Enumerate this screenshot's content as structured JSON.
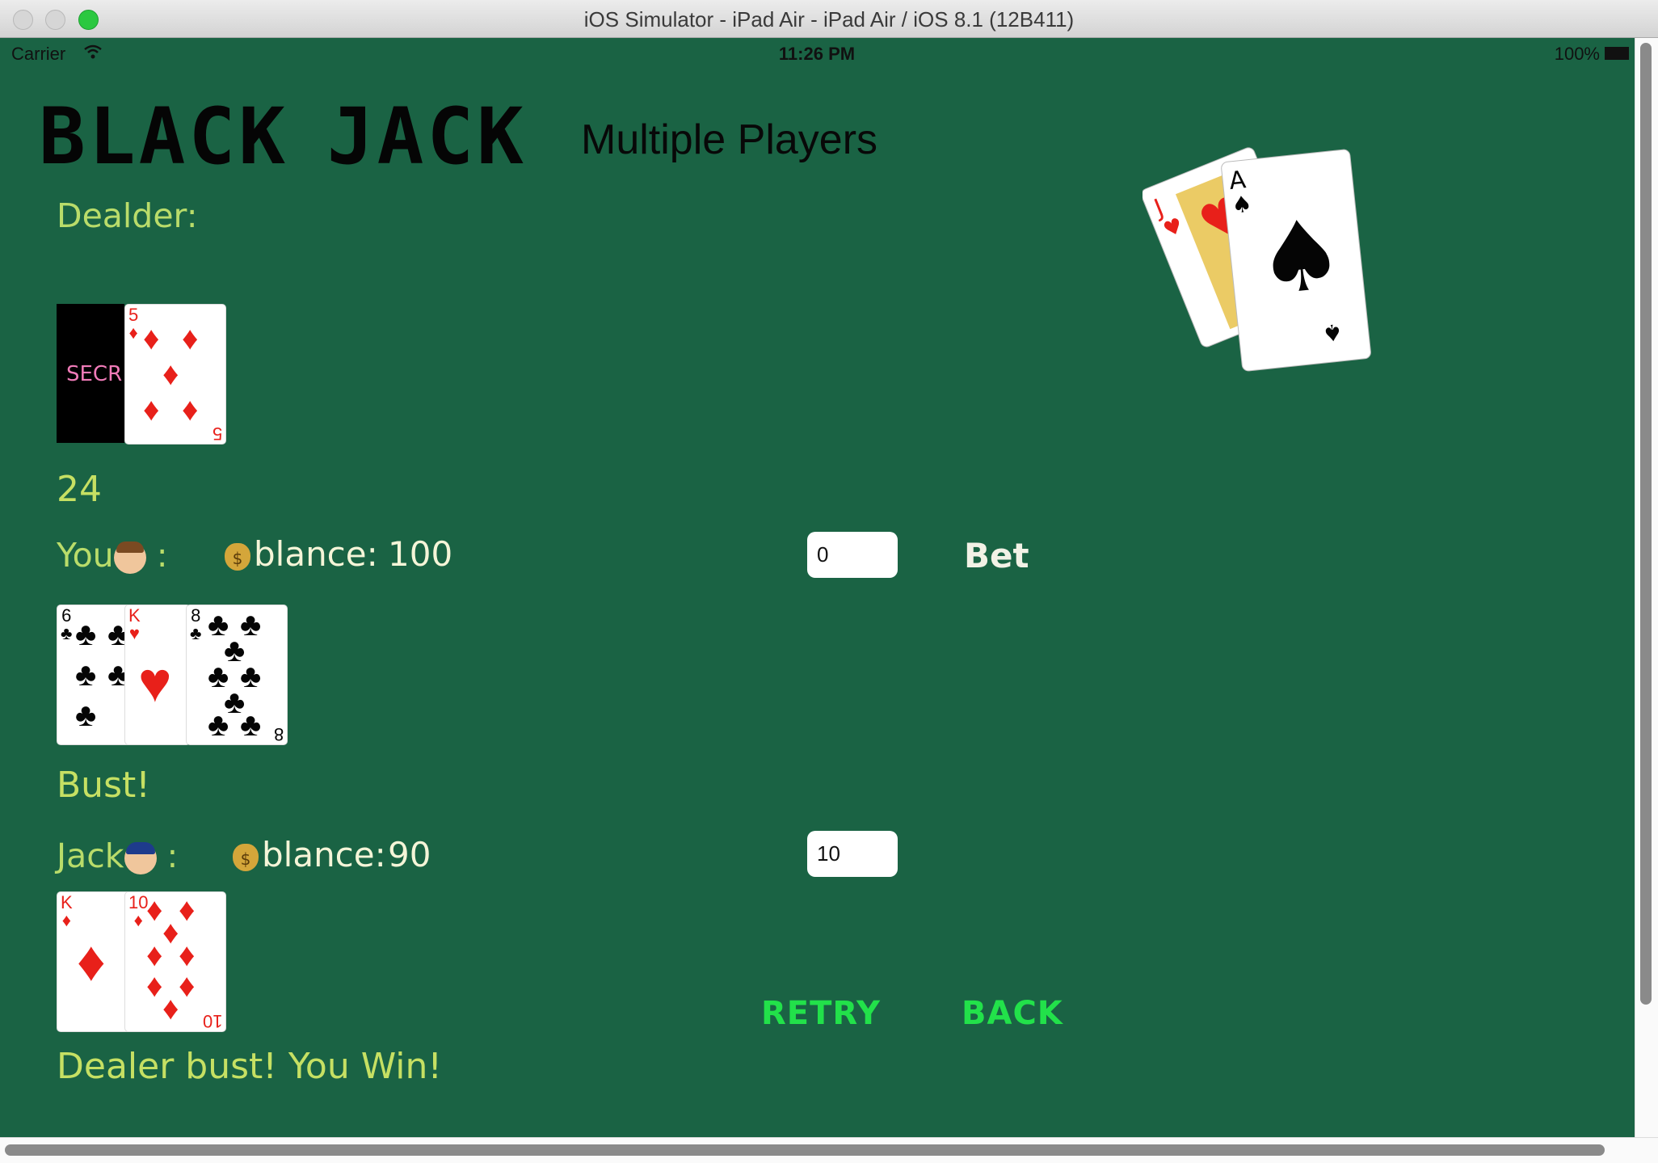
{
  "window": {
    "title": "iOS Simulator - iPad Air - iPad Air / iOS 8.1 (12B411)"
  },
  "status_bar": {
    "carrier": "Carrier",
    "time": "11:26 PM",
    "battery": "100%"
  },
  "header": {
    "title": "BLACK JACK",
    "subtitle": "Multiple Players"
  },
  "dealer": {
    "label": "Dealder:",
    "hidden_card_text": "SECR",
    "cards": [
      {
        "rank": "5",
        "suit": "♦",
        "color": "#e8201a"
      }
    ],
    "total": "24"
  },
  "players": [
    {
      "label": "You",
      "avatar": "boy-face-icon",
      "balance_label": "blance:",
      "balance": "100",
      "bet_value": "0",
      "cards": [
        {
          "rank": "6",
          "suit": "♣"
        },
        {
          "rank": "K",
          "suit": "♥"
        },
        {
          "rank": "8",
          "suit": "♣"
        }
      ],
      "result": "Bust!"
    },
    {
      "label": "Jack",
      "avatar": "police-face-icon",
      "balance_label": "blance:",
      "balance": "90",
      "bet_value": "10",
      "cards": [
        {
          "rank": "K",
          "suit": "♦"
        },
        {
          "rank": "10",
          "suit": "♦"
        }
      ],
      "result": "Dealer bust! You Win!"
    }
  ],
  "bet_button": "Bet",
  "actions": {
    "retry": "RETRY",
    "back": "BACK"
  },
  "colors": {
    "felt": "#1a6344",
    "label": "#b9dc6a",
    "action": "#22e14a"
  },
  "decoration": {
    "cards": [
      "J♥",
      "A♠"
    ]
  }
}
